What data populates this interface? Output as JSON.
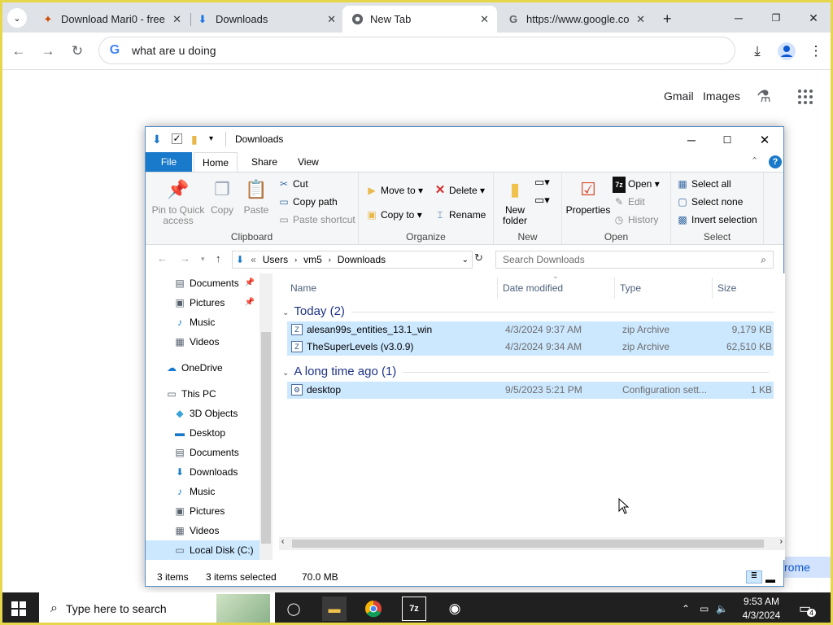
{
  "chrome": {
    "tabs": [
      {
        "title": "Download Mari0 - free",
        "icon": "mario-favicon"
      },
      {
        "title": "Downloads",
        "icon": "download-favicon"
      },
      {
        "title": "New Tab",
        "icon": "chrome-favicon"
      },
      {
        "title": "https://www.google.co",
        "icon": "google-favicon"
      }
    ],
    "omnibox_text": "what are u doing",
    "gmail": "Gmail",
    "images": "Images",
    "chrome_button_partial": "rome"
  },
  "explorer": {
    "title": "Downloads",
    "ribbon_tabs": [
      "File",
      "Home",
      "Share",
      "View"
    ],
    "clipboard": {
      "pin_label": "Pin to Quick access",
      "copy_label": "Copy",
      "paste_label": "Paste",
      "cut_label": "Cut",
      "copy_path_label": "Copy path",
      "paste_shortcut_label": "Paste shortcut",
      "group_label": "Clipboard"
    },
    "organize": {
      "move_to_label": "Move to",
      "copy_to_label": "Copy to",
      "delete_label": "Delete",
      "rename_label": "Rename",
      "group_label": "Organize"
    },
    "new": {
      "new_folder_label": "New folder",
      "group_label": "New"
    },
    "open": {
      "properties_label": "Properties",
      "open_label": "Open",
      "edit_label": "Edit",
      "history_label": "History",
      "group_label": "Open"
    },
    "select": {
      "select_all_label": "Select all",
      "select_none_label": "Select none",
      "invert_label": "Invert selection",
      "group_label": "Select"
    },
    "breadcrumb": [
      "Users",
      "vm5",
      "Downloads"
    ],
    "search_placeholder": "Search Downloads",
    "nav_items": [
      {
        "label": "Documents",
        "icon": "documents-icon",
        "pinned": true
      },
      {
        "label": "Pictures",
        "icon": "pictures-icon",
        "pinned": true
      },
      {
        "label": "Music",
        "icon": "music-icon",
        "pinned": false
      },
      {
        "label": "Videos",
        "icon": "videos-icon",
        "pinned": false
      },
      {
        "label": "OneDrive",
        "icon": "onedrive-icon",
        "pinned": false
      },
      {
        "label": "This PC",
        "icon": "this-pc-icon",
        "pinned": false
      },
      {
        "label": "3D Objects",
        "icon": "3d-objects-icon",
        "pinned": false
      },
      {
        "label": "Desktop",
        "icon": "desktop-icon",
        "pinned": false
      },
      {
        "label": "Documents",
        "icon": "documents-icon",
        "pinned": false
      },
      {
        "label": "Downloads",
        "icon": "downloads-icon",
        "pinned": false
      },
      {
        "label": "Music",
        "icon": "music-icon",
        "pinned": false
      },
      {
        "label": "Pictures",
        "icon": "pictures-icon",
        "pinned": false
      },
      {
        "label": "Videos",
        "icon": "videos-icon",
        "pinned": false
      },
      {
        "label": "Local Disk (C:)",
        "icon": "local-disk-icon",
        "pinned": false
      }
    ],
    "columns": [
      "Name",
      "Date modified",
      "Type",
      "Size"
    ],
    "groups": [
      {
        "label": "Today (2)",
        "files": [
          {
            "name": "alesan99s_entities_13.1_win",
            "date": "4/3/2024 9:37 AM",
            "type": "zip Archive",
            "size": "9,179 KB",
            "selected": true
          },
          {
            "name": "TheSuperLevels (v3.0.9)",
            "date": "4/3/2024 9:34 AM",
            "type": "zip Archive",
            "size": "62,510 KB",
            "selected": true
          }
        ]
      },
      {
        "label": "A long time ago (1)",
        "files": [
          {
            "name": "desktop",
            "date": "9/5/2023 5:21 PM",
            "type": "Configuration sett...",
            "size": "1 KB",
            "selected": true
          }
        ]
      }
    ],
    "status": {
      "count": "3 items",
      "selected": "3 items selected",
      "size": "70.0 MB"
    }
  },
  "taskbar": {
    "search_placeholder": "Type here to search",
    "time": "9:53 AM",
    "date": "4/3/2024",
    "notification_count": "4"
  },
  "colors": {
    "accent": "#1979ca",
    "selection": "#cce8ff",
    "taskbar": "#202020"
  }
}
